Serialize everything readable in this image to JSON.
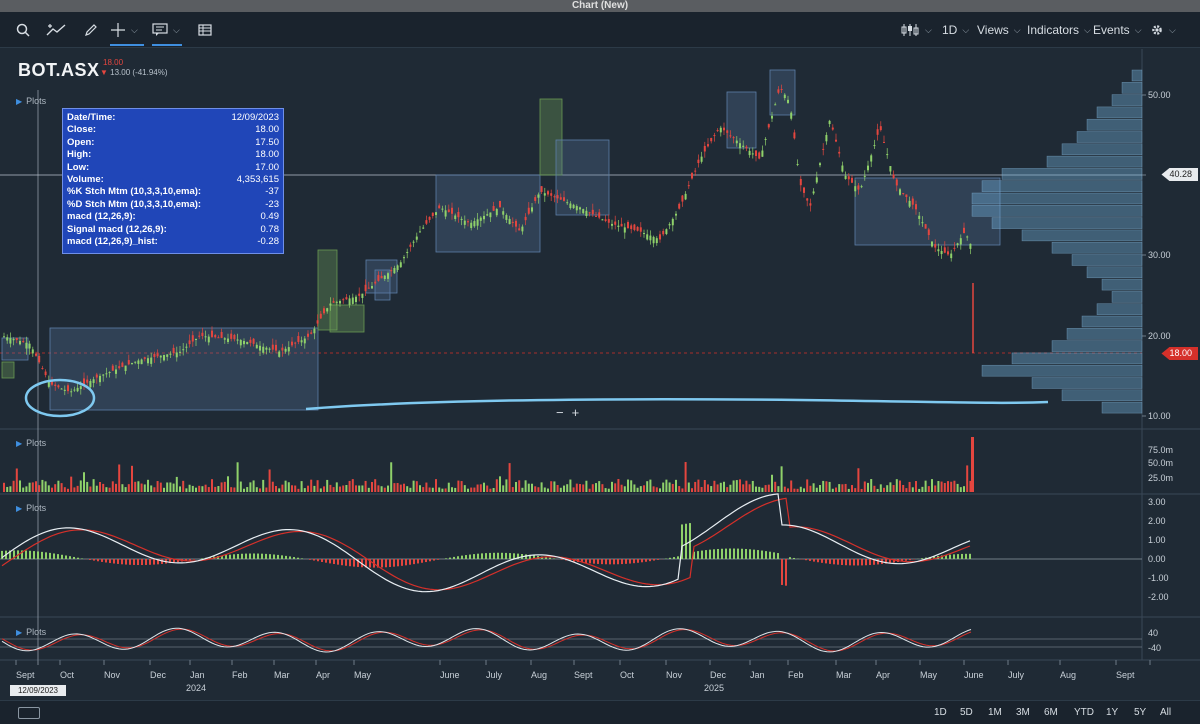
{
  "window": {
    "title": "Chart (New)"
  },
  "toolbar": {
    "interval": "1D",
    "views": "Views",
    "indicators": "Indicators",
    "events": "Events"
  },
  "symbol": {
    "name": "BOT.ASX",
    "last_price": "18.00",
    "change": "13.00 (-41.94%)"
  },
  "panes": {
    "plots_label": "Plots"
  },
  "tooltip": {
    "rows": [
      {
        "k": "Date/Time:",
        "v": "12/09/2023"
      },
      {
        "k": "Close:",
        "v": "18.00"
      },
      {
        "k": "Open:",
        "v": "17.50"
      },
      {
        "k": "High:",
        "v": "18.00"
      },
      {
        "k": "Low:",
        "v": "17.00"
      },
      {
        "k": "Volume:",
        "v": "4,353,615"
      },
      {
        "k": "%K Stch Mtm (10,3,3,10,ema):",
        "v": "-37"
      },
      {
        "k": "%D Stch Mtm (10,3,3,10,ema):",
        "v": "-23"
      },
      {
        "k": "macd (12,26,9):",
        "v": "0.49"
      },
      {
        "k": "Signal macd (12,26,9):",
        "v": "0.78"
      },
      {
        "k": "macd (12,26,9)_hist:",
        "v": "-0.28"
      }
    ]
  },
  "price_axis": {
    "ticks": [
      "50.00",
      "40.00",
      "30.00",
      "20.00",
      "10.00"
    ],
    "crosshair_tag": "40.28",
    "last_tag": "18.00"
  },
  "volume_axis": {
    "ticks": [
      "75.0m",
      "50.0m",
      "25.0m"
    ]
  },
  "macd_axis": {
    "ticks": [
      "3.00",
      "2.00",
      "1.00",
      "0.00",
      "-1.00",
      "-2.00"
    ]
  },
  "stoch_axis": {
    "ticks": [
      "40",
      "-40"
    ]
  },
  "time_axis": {
    "months": [
      "Sept",
      "Oct",
      "Nov",
      "Dec",
      "Jan",
      "Feb",
      "Mar",
      "Apr",
      "May",
      "June",
      "July",
      "Aug",
      "Sept",
      "Oct",
      "Nov",
      "Dec",
      "Jan",
      "Feb",
      "Mar",
      "Apr",
      "May",
      "June",
      "July",
      "Aug",
      "Sept",
      "Oct"
    ],
    "years": [
      "2024",
      "2025"
    ],
    "crosshair_date": "12/09/2023"
  },
  "zoom": {
    "minus": "−",
    "plus": "+"
  },
  "ranges": [
    "1D",
    "5D",
    "1M",
    "3M",
    "6M",
    "YTD",
    "1Y",
    "5Y",
    "All"
  ],
  "colors": {
    "up": "#8fd16a",
    "down": "#e4463f",
    "macd": "#e8eef3",
    "signal": "#d5302a",
    "highlight": "#7fc9f0",
    "box": "#5c7ea8"
  }
}
